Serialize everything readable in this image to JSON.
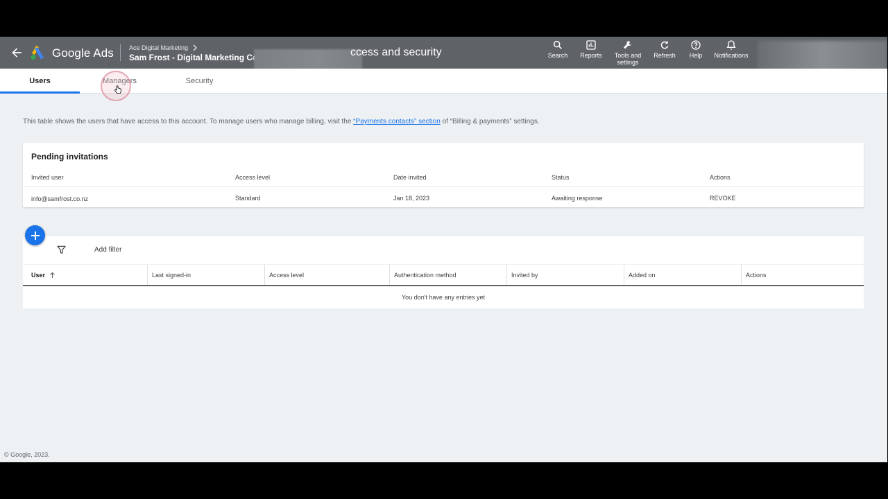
{
  "header": {
    "brand": "Google Ads",
    "account_parent": "Ace Digital Marketing",
    "account_name": "Sam Frost - Digital Marketing Cor",
    "page_title": "ccess and security",
    "tools": [
      {
        "label": "Search",
        "icon": "search-icon"
      },
      {
        "label": "Reports",
        "icon": "reports-icon"
      },
      {
        "label": "Tools and settings",
        "icon": "wrench-icon"
      },
      {
        "label": "Refresh",
        "icon": "refresh-icon"
      },
      {
        "label": "Help",
        "icon": "help-icon"
      },
      {
        "label": "Notifications",
        "icon": "bell-icon"
      }
    ]
  },
  "tabs": [
    {
      "label": "Users",
      "active": true
    },
    {
      "label": "Managers",
      "active": false
    },
    {
      "label": "Security",
      "active": false
    }
  ],
  "info": {
    "before": "This table shows the users that have access to this account. To manage users who manage billing, visit the ",
    "link": "“Payments contacts” section",
    "after": " of “Billing & payments” settings."
  },
  "pending": {
    "title": "Pending invitations",
    "columns": [
      "Invited user",
      "Access level",
      "Date invited",
      "Status",
      "Actions"
    ],
    "rows": [
      {
        "user": "info@samfrost.co.nz",
        "access": "Standard",
        "date": "Jan 18, 2023",
        "status": "Awaiting response",
        "action": "REVOKE"
      }
    ]
  },
  "filter": {
    "label": "Add filter"
  },
  "users_table": {
    "columns": [
      "User",
      "Last signed-in",
      "Access level",
      "Authentication method",
      "Invited by",
      "Added on",
      "Actions"
    ],
    "empty_text": "You don't have any entries yet"
  },
  "footer": "© Google, 2023.",
  "colors": {
    "accent": "#1a73e8",
    "header_bg": "#5f6368",
    "page_bg": "#eef1f3"
  }
}
